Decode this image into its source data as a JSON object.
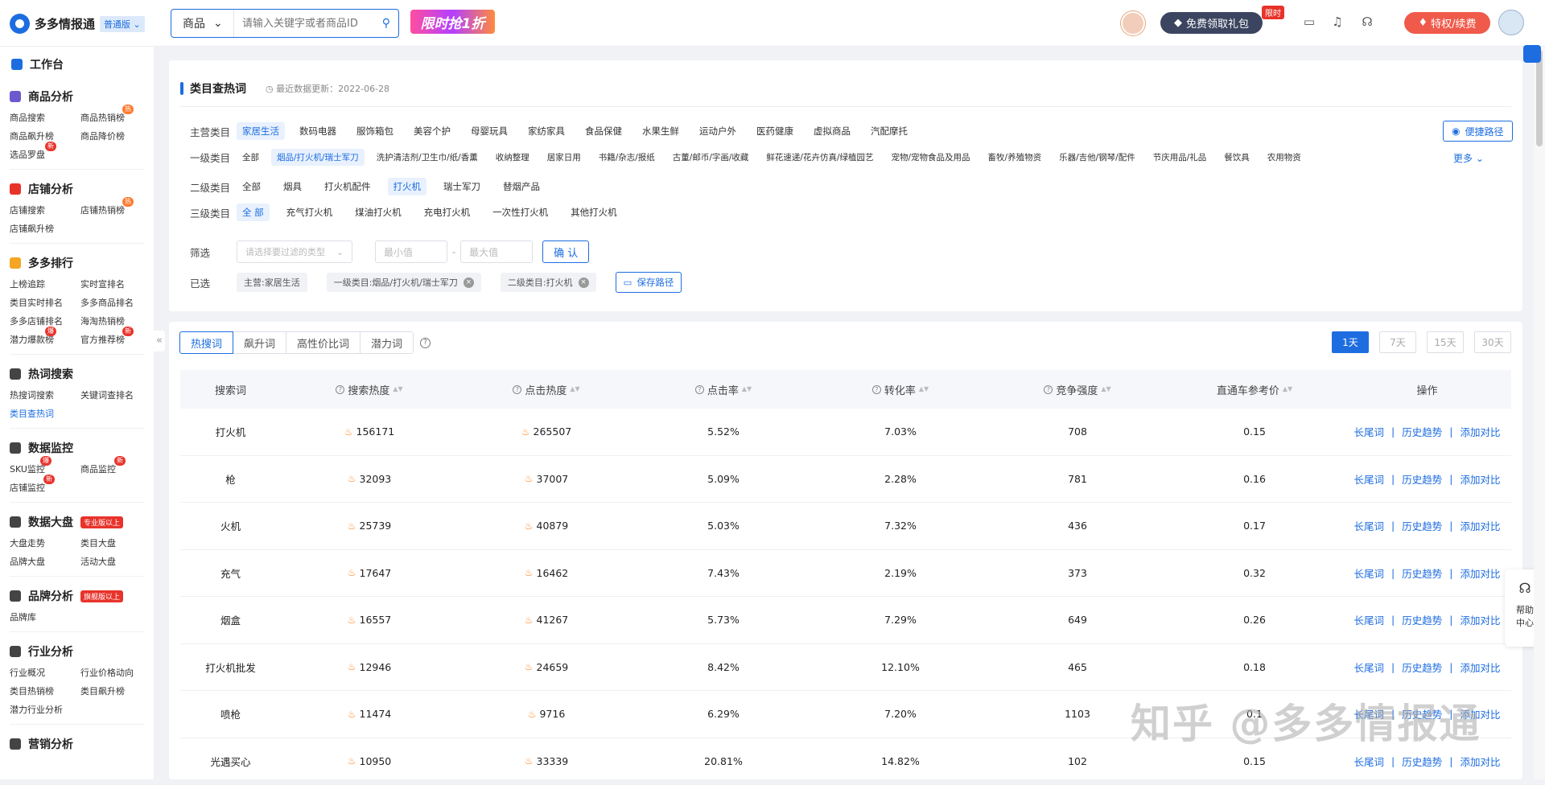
{
  "topbar": {
    "logo_text": "多多情报通",
    "version_badge": "普通版",
    "search_category": "商品",
    "search_placeholder": "请输入关键字或者商品ID",
    "promo_text": "限时抢1折",
    "gift_label": "免费领取礼包",
    "limit_badge": "限时",
    "vip_label": "特权/续费"
  },
  "sidebar": {
    "dashboard": "工作台",
    "sections": [
      {
        "title": "商品分析",
        "items": [
          "商品搜索",
          "商品热销榜",
          "商品飙升榜",
          "商品降价榜",
          "选品罗盘"
        ]
      },
      {
        "title": "店铺分析",
        "items": [
          "店铺搜索",
          "店铺热销榜",
          "店铺飙升榜"
        ]
      },
      {
        "title": "多多排行",
        "items": [
          "上榜追踪",
          "实时宣排名",
          "类目实时排名",
          "多多商品排名",
          "多多店铺排名",
          "海淘热销榜",
          "潜力爆款榜",
          "官方推荐榜"
        ]
      },
      {
        "title": "热词搜索",
        "items": [
          "热搜词搜索",
          "关键词查排名",
          "类目查热词"
        ]
      },
      {
        "title": "数据监控",
        "items": [
          "SKU监控",
          "商品监控",
          "店铺监控"
        ]
      },
      {
        "title": "数据大盘",
        "tag": "专业版以上",
        "items": [
          "大盘走势",
          "类目大盘",
          "品牌大盘",
          "活动大盘"
        ]
      },
      {
        "title": "品牌分析",
        "tag": "旗舰版以上",
        "items": [
          "品牌库"
        ]
      },
      {
        "title": "行业分析",
        "items": [
          "行业概况",
          "行业价格动向",
          "类目热销榜",
          "类目飙升榜",
          "潜力行业分析"
        ]
      },
      {
        "title": "营销分析",
        "items": []
      }
    ],
    "badge_hot": "热",
    "badge_new": "新",
    "badge_explode": "爆"
  },
  "filter": {
    "title": "类目查热词",
    "update_text": "最近数据更新：2022-06-28",
    "fav_path": "便捷路径",
    "more": "更多",
    "main_label": "主营类目",
    "main_cats": [
      "家居生活",
      "数码电器",
      "服饰箱包",
      "美容个护",
      "母婴玩具",
      "家纺家具",
      "食品保健",
      "水果生鲜",
      "运动户外",
      "医药健康",
      "虚拟商品",
      "汽配摩托"
    ],
    "l1_label": "一级类目",
    "l1_cats": [
      "全部",
      "烟品/打火机/瑞士军刀",
      "洗护清洁剂/卫生巾/纸/香薰",
      "收纳整理",
      "居家日用",
      "书籍/杂志/报纸",
      "古董/邮币/字画/收藏",
      "鲜花速递/花卉仿真/绿植园艺",
      "宠物/宠物食品及用品",
      "畜牧/养殖物资",
      "乐器/吉他/钢琴/配件",
      "节庆用品/礼品",
      "餐饮具",
      "农用物资"
    ],
    "l2_label": "二级类目",
    "l2_cats": [
      "全部",
      "烟具",
      "打火机配件",
      "打火机",
      "瑞士军刀",
      "替烟产品"
    ],
    "l3_label": "三级类目",
    "l3_cats": [
      "全 部",
      "充气打火机",
      "煤油打火机",
      "充电打火机",
      "一次性打火机",
      "其他打火机"
    ],
    "screen_label": "筛选",
    "select_placeholder": "请选择要过滤的类型",
    "min_placeholder": "最小值",
    "max_placeholder": "最大值",
    "confirm": "确 认",
    "selected_label": "已选",
    "selected": [
      "主营:家居生活",
      "一级类目:烟品/打火机/瑞士军刀",
      "二级类目:打火机"
    ],
    "save_path": "保存路径"
  },
  "results": {
    "tabs": [
      "热搜词",
      "飙升词",
      "高性价比词",
      "潜力词"
    ],
    "days": [
      "1天",
      "7天",
      "15天",
      "30天"
    ],
    "columns": [
      "搜索词",
      "搜索热度",
      "点击热度",
      "点击率",
      "转化率",
      "竞争强度",
      "直通车参考价",
      "操作"
    ],
    "actions": [
      "长尾词",
      "历史趋势",
      "添加对比"
    ],
    "rows": [
      {
        "word": "打火机",
        "search_heat": "156171",
        "click_heat": "265507",
        "ctr": "5.52%",
        "cvr": "7.03%",
        "competition": "708",
        "price": "0.15"
      },
      {
        "word": "枪",
        "search_heat": "32093",
        "click_heat": "37007",
        "ctr": "5.09%",
        "cvr": "2.28%",
        "competition": "781",
        "price": "0.16"
      },
      {
        "word": "火机",
        "search_heat": "25739",
        "click_heat": "40879",
        "ctr": "5.03%",
        "cvr": "7.32%",
        "competition": "436",
        "price": "0.17"
      },
      {
        "word": "充气",
        "search_heat": "17647",
        "click_heat": "16462",
        "ctr": "7.43%",
        "cvr": "2.19%",
        "competition": "373",
        "price": "0.32"
      },
      {
        "word": "烟盒",
        "search_heat": "16557",
        "click_heat": "41267",
        "ctr": "5.73%",
        "cvr": "7.29%",
        "competition": "649",
        "price": "0.26"
      },
      {
        "word": "打火机批发",
        "search_heat": "12946",
        "click_heat": "24659",
        "ctr": "8.42%",
        "cvr": "12.10%",
        "competition": "465",
        "price": "0.18"
      },
      {
        "word": "喷枪",
        "search_heat": "11474",
        "click_heat": "9716",
        "ctr": "6.29%",
        "cvr": "7.20%",
        "competition": "1103",
        "price": "0.1"
      },
      {
        "word": "光遇买心",
        "search_heat": "10950",
        "click_heat": "33339",
        "ctr": "20.81%",
        "cvr": "14.82%",
        "competition": "102",
        "price": "0.15"
      }
    ]
  },
  "help": {
    "line1": "帮助",
    "line2": "中心"
  },
  "watermark": "知乎 @多多情报通",
  "colors": {
    "accent": "#1d6de0",
    "vip": "#f05a4a",
    "badge": "#e8332b"
  }
}
